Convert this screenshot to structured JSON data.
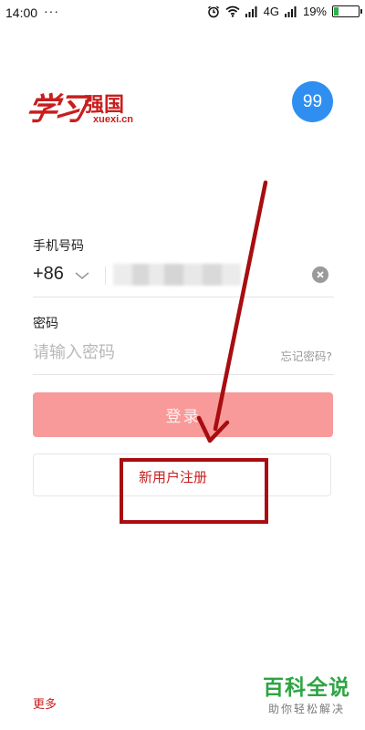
{
  "status_bar": {
    "time": "14:00",
    "dots": "···",
    "network": "4G",
    "battery_percent": "19%",
    "battery_level": 0.19,
    "icons": [
      "alarm-icon",
      "wifi-icon",
      "signal-icon",
      "signal-icon",
      "battery-icon"
    ]
  },
  "logo": {
    "calligraphy": "学习",
    "name": "强国",
    "domain": "xuexi.cn"
  },
  "badge": "99",
  "form": {
    "phone_label": "手机号码",
    "country_code": "+86",
    "phone_value": "",
    "password_label": "密码",
    "password_placeholder": "请输入密码",
    "forgot_password": "忘记密码?",
    "login_button": "登录",
    "register_button": "新用户注册"
  },
  "footer": {
    "more": "更多"
  },
  "watermark": {
    "title": "百科全说",
    "subtitle": "助你轻松解决"
  },
  "colors": {
    "brand_red": "#c81e1e",
    "login_button": "#f89a9a",
    "badge_blue": "#2f8ff0",
    "annotation": "#a80d10",
    "watermark_green": "#2da543"
  }
}
